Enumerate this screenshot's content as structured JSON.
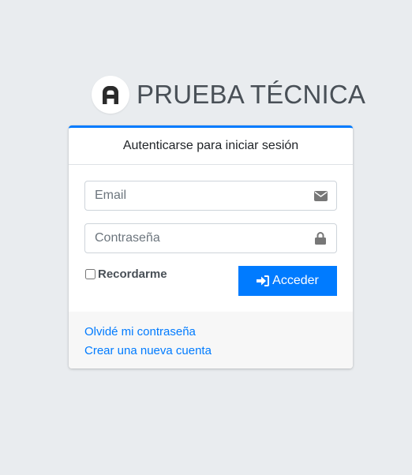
{
  "brand": {
    "title": "PRUEBA TÉCNICA",
    "logo_letter": "A"
  },
  "card": {
    "header": "Autenticarse para iniciar sesión",
    "accent_color": "#007bff"
  },
  "form": {
    "email": {
      "placeholder": "Email",
      "value": "",
      "icon": "envelope-icon"
    },
    "password": {
      "placeholder": "Contraseña",
      "value": "",
      "icon": "lock-icon"
    },
    "remember_label": "Recordarme",
    "remember_checked": false,
    "submit_label": "Acceder",
    "submit_icon": "sign-in-icon"
  },
  "footer": {
    "forgot_link": "Olvidé mi contraseña",
    "register_link": "Crear una nueva cuenta"
  },
  "colors": {
    "background": "#e9ecef",
    "primary": "#007bff",
    "footer_bg": "#f7f7f7"
  }
}
